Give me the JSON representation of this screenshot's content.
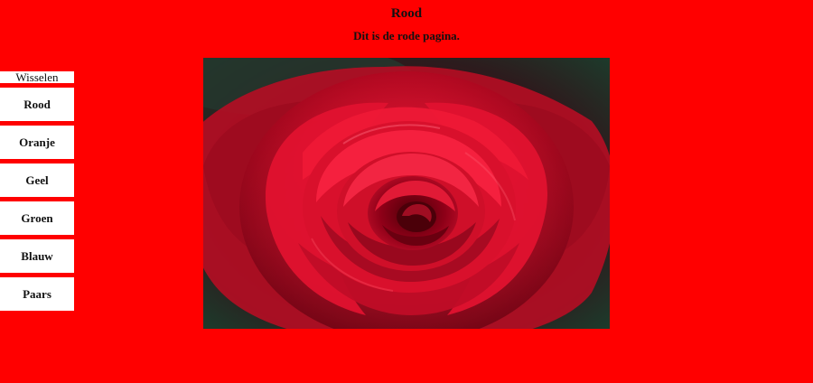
{
  "header": {
    "title": "Rood",
    "subtitle": "Dit is de rode pagina."
  },
  "sidebar": {
    "header": "Wisselen",
    "items": [
      {
        "label": "Rood"
      },
      {
        "label": "Oranje"
      },
      {
        "label": "Geel"
      },
      {
        "label": "Groen"
      },
      {
        "label": "Blauw"
      },
      {
        "label": "Paars"
      }
    ]
  },
  "colors": {
    "page_background": "#ff0000",
    "button_background": "#ffffff"
  },
  "image": {
    "icon": "red-rose-photo"
  }
}
